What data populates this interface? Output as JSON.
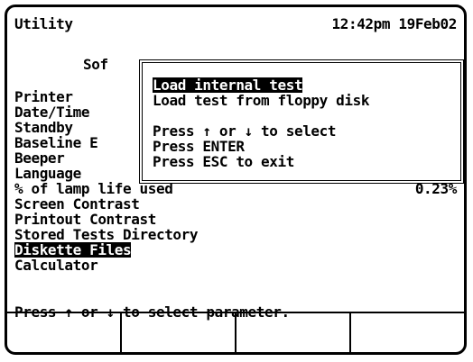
{
  "header": {
    "title": "Utility",
    "datetime": "12:42pm 19Feb02"
  },
  "menu": {
    "items": [
      {
        "label": "Sof"
      },
      {
        "label": "Printer"
      },
      {
        "label": "Date/Time"
      },
      {
        "label": "Standby"
      },
      {
        "label": "Baseline E"
      },
      {
        "label": "Beeper"
      },
      {
        "label": "Language"
      },
      {
        "label": "% of lamp life used",
        "value": "0.23%"
      },
      {
        "label": "Screen Contrast"
      },
      {
        "label": "Printout Contrast"
      },
      {
        "label": "Stored Tests Directory"
      },
      {
        "label": "Diskette Files",
        "selected": true
      },
      {
        "label": "Calculator"
      }
    ]
  },
  "popup": {
    "options": [
      {
        "label": "Load internal test",
        "selected": true
      },
      {
        "label": "Load test from floppy disk"
      }
    ],
    "instructions": [
      "Press ↑ or ↓ to select",
      "Press ENTER",
      "Press ESC to exit"
    ]
  },
  "status": {
    "text": "Press ↑ or ↓ to select parameter."
  },
  "softkeys": [
    "",
    "",
    "",
    ""
  ]
}
